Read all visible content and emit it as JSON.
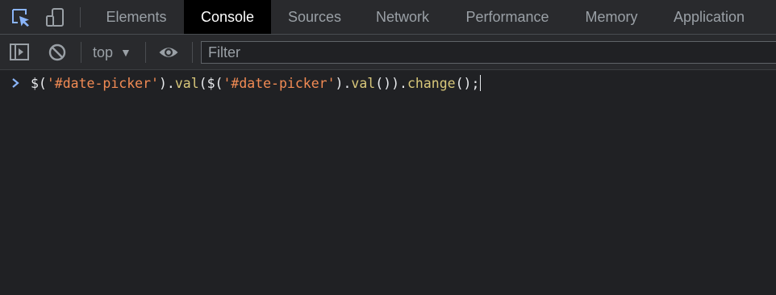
{
  "tabs": [
    {
      "label": "Elements",
      "active": false
    },
    {
      "label": "Console",
      "active": true
    },
    {
      "label": "Sources",
      "active": false
    },
    {
      "label": "Network",
      "active": false
    },
    {
      "label": "Performance",
      "active": false
    },
    {
      "label": "Memory",
      "active": false
    },
    {
      "label": "Application",
      "active": false
    }
  ],
  "toolbar_icons": [
    "inspect-element-icon",
    "device-toolbar-icon"
  ],
  "console_toolbar": {
    "sidebar_icon": "show-sidebar-icon",
    "clear_icon": "clear-console-icon",
    "context": "top",
    "context_caret": "▼",
    "eye_icon": "live-expression-eye-icon",
    "filter_placeholder": "Filter"
  },
  "console": {
    "prompt_icon": "chevron-right-icon",
    "input_tokens": [
      {
        "text": "$(",
        "kind": "punct"
      },
      {
        "text": "'#date-picker'",
        "kind": "str"
      },
      {
        "text": ").",
        "kind": "punct"
      },
      {
        "text": "val",
        "kind": "prop"
      },
      {
        "text": "($(",
        "kind": "punct"
      },
      {
        "text": "'#date-picker'",
        "kind": "str"
      },
      {
        "text": ").",
        "kind": "punct"
      },
      {
        "text": "val",
        "kind": "prop"
      },
      {
        "text": "()).",
        "kind": "punct"
      },
      {
        "text": "change",
        "kind": "prop"
      },
      {
        "text": "();",
        "kind": "punct"
      }
    ]
  },
  "colors": {
    "background": "#202124",
    "toolbar": "#292a2d",
    "active_tab": "#000000",
    "accent_blue": "#8ab4f8",
    "string": "#f28b54",
    "property": "#d9c87a"
  }
}
